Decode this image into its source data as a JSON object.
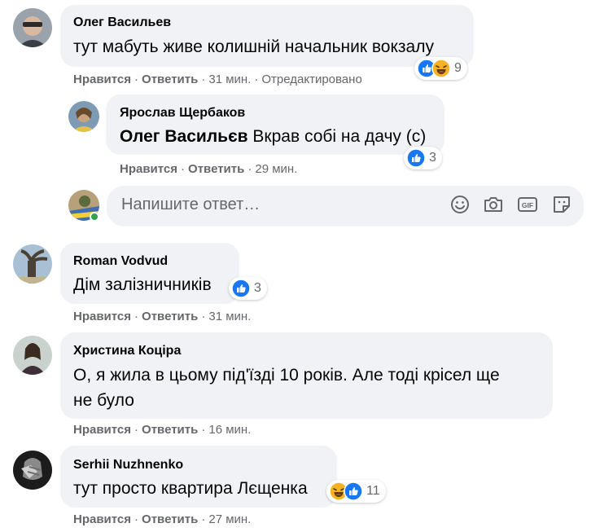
{
  "comments": [
    {
      "author": "Олег Васильев",
      "text": "тут мабуть живе колишній начальник вокзалу",
      "reaction_count": "9",
      "reactions": [
        "like-icon",
        "haha-icon"
      ],
      "like_label": "Нравится",
      "reply_label": "Ответить",
      "time": "31 мин.",
      "edited_label": "Отредактировано"
    },
    {
      "author": "Roman Vodvud",
      "text": "Дім залізничників",
      "reaction_count": "3",
      "reactions": [
        "like-icon"
      ],
      "like_label": "Нравится",
      "reply_label": "Ответить",
      "time": "31 мин."
    },
    {
      "author": "Христина Коціра",
      "text_line1": "О, я жила в цьому під'їзді 10 років. Але тоді крісел ще",
      "text_line2": "не було",
      "like_label": "Нравится",
      "reply_label": "Ответить",
      "time": "16 мин."
    },
    {
      "author": "Serhii Nuzhnenko",
      "text": "тут просто квартира Лєщенка",
      "reaction_count": "11",
      "reactions": [
        "haha-icon",
        "like-icon"
      ],
      "like_label": "Нравится",
      "reply_label": "Ответить",
      "time": "27 мин."
    }
  ],
  "reply": {
    "author": "Ярослав Щербаков",
    "mention": "Олег Васильєв",
    "text": " Вкрав собі на дачу (с)",
    "reaction_count": "3",
    "reactions": [
      "like-icon"
    ],
    "like_label": "Нравится",
    "reply_label": "Ответить",
    "time": "29 мин."
  },
  "reply_input": {
    "placeholder": "Напишите ответ…",
    "tools": [
      "emoji-icon",
      "camera-icon",
      "gif-icon",
      "sticker-icon"
    ]
  },
  "colors": {
    "bubble": "#f0f2f5",
    "meta_text": "#65676b",
    "like_blue": "#1877f2",
    "haha_yellow": "#f7b125",
    "online_green": "#31a24c"
  }
}
